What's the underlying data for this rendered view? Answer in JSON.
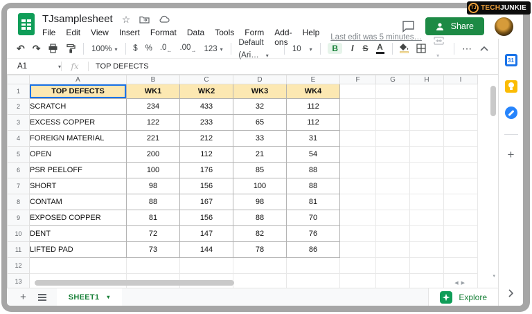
{
  "brand": {
    "logo_initials": "TJ",
    "badge_tech": "TECH",
    "badge_junkie": "JUNKIE"
  },
  "header": {
    "title": "TJsamplesheet",
    "menus": [
      "File",
      "Edit",
      "View",
      "Insert",
      "Format",
      "Data",
      "Tools",
      "Form",
      "Add-ons",
      "Help"
    ],
    "last_edit": "Last edit was 5 minutes…",
    "share_label": "Share"
  },
  "toolbar": {
    "zoom_value": "100%",
    "currency": "$",
    "percent": "%",
    "decimal_decrease": ".0",
    "decimal_increase": ".00",
    "number_format": "123",
    "font_family": "Default (Ari…",
    "font_size": "10",
    "bold": "B",
    "italic": "I",
    "strikethrough": "S",
    "text_color": "A",
    "more": "⋯"
  },
  "formula_bar": {
    "cell_ref": "A1",
    "fx_label": "fx",
    "value": "TOP DEFECTS"
  },
  "grid": {
    "column_headers": [
      "A",
      "B",
      "C",
      "D",
      "E",
      "F",
      "G",
      "H",
      "I"
    ],
    "row_numbers": [
      "1",
      "2",
      "3",
      "4",
      "5",
      "6",
      "7",
      "8",
      "9",
      "10",
      "11",
      "12",
      "13"
    ],
    "table": {
      "headers": [
        "TOP DEFECTS",
        "WK1",
        "WK2",
        "WK3",
        "WK4"
      ],
      "rows": [
        [
          "SCRATCH",
          "234",
          "433",
          "32",
          "112"
        ],
        [
          "EXCESS COPPER",
          "122",
          "233",
          "65",
          "112"
        ],
        [
          "FOREIGN MATERIAL",
          "221",
          "212",
          "33",
          "31"
        ],
        [
          "OPEN",
          "200",
          "112",
          "21",
          "54"
        ],
        [
          "PSR PEELOFF",
          "100",
          "176",
          "85",
          "88"
        ],
        [
          "SHORT",
          "98",
          "156",
          "100",
          "88"
        ],
        [
          "CONTAM",
          "88",
          "167",
          "98",
          "81"
        ],
        [
          "EXPOSED COPPER",
          "81",
          "156",
          "88",
          "70"
        ],
        [
          "DENT",
          "72",
          "147",
          "82",
          "76"
        ],
        [
          "LIFTED PAD",
          "73",
          "144",
          "78",
          "86"
        ]
      ]
    }
  },
  "sidebar": {
    "calendar_label": "31"
  },
  "footer": {
    "sheet_tab": "SHEET1",
    "explore_label": "Explore"
  },
  "colors": {
    "accent_green": "#188038",
    "logo_green": "#0f9d58",
    "share_green": "#1d8a45",
    "header_fill": "#fce8b2",
    "selection_blue": "#1a73e8",
    "badge_orange": "#f2a33c",
    "frame_gray": "#a6a6a6"
  }
}
